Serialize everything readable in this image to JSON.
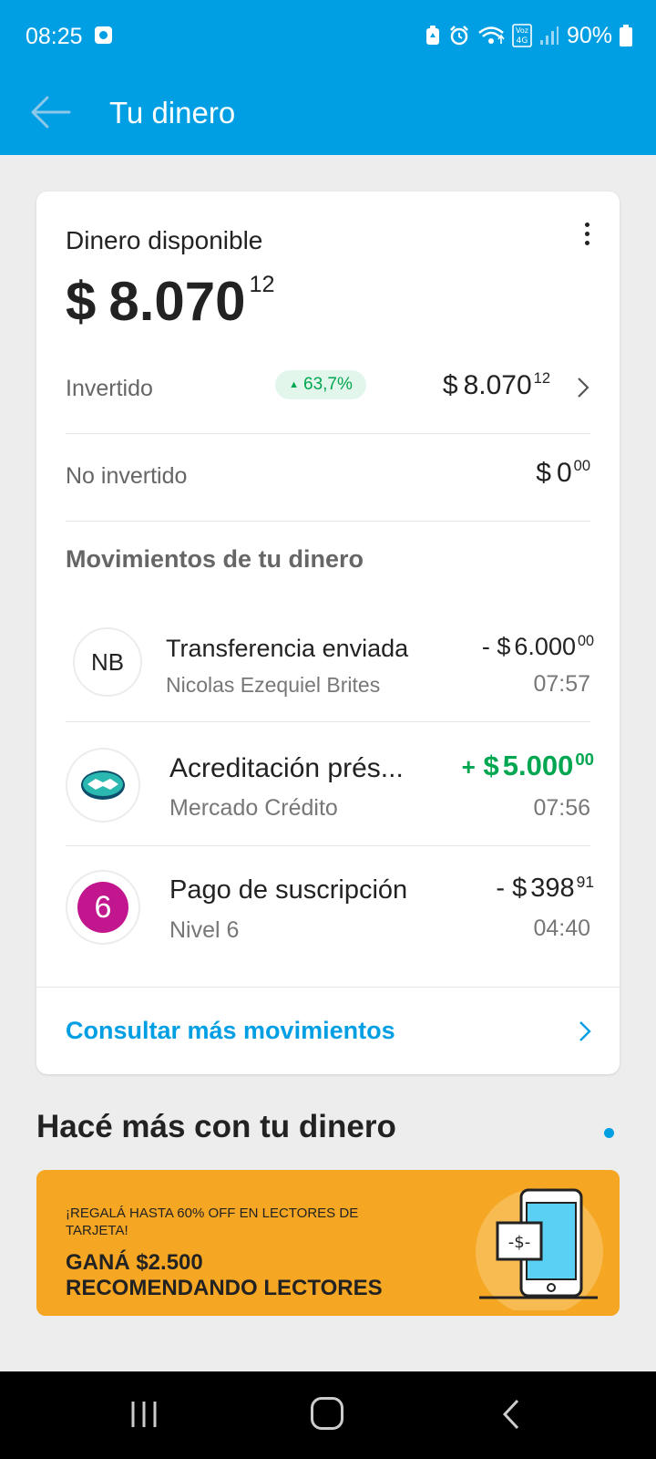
{
  "status_bar": {
    "time": "08:25",
    "battery": "90%",
    "network": "Voz 4G",
    "icons": [
      "notification-icon",
      "battery-saver-icon",
      "alarm-icon",
      "wifi-icon",
      "volte-icon",
      "signal-icon",
      "battery-icon"
    ]
  },
  "header": {
    "title": "Tu dinero",
    "back_icon": "arrow-left-icon",
    "color": "#009ee3"
  },
  "balance": {
    "label": "Dinero disponible",
    "currency": "$",
    "integer": "8.070",
    "cents": "12",
    "menu_icon": "more-vertical-icon"
  },
  "breakdown": [
    {
      "label": "Invertido",
      "badge": "63,7%",
      "badge_trend": "up",
      "currency": "$",
      "integer": "8.070",
      "cents": "12",
      "has_chevron": true
    },
    {
      "label": "No invertido",
      "currency": "$",
      "integer": "0",
      "cents": "00",
      "has_chevron": false
    }
  ],
  "movements": {
    "title": "Movimientos de tu dinero",
    "items": [
      {
        "avatar": "NB",
        "title": "Transferencia enviada",
        "subtitle": "Nicolas Ezequiel Brites",
        "sign": "-",
        "currency": "$",
        "integer": "6.000",
        "cents": "00",
        "time": "07:57",
        "type": "debit"
      },
      {
        "avatar_icon": "handshake-icon",
        "title": "Acreditación prés...",
        "subtitle": "Mercado Crédito",
        "sign": "+",
        "currency": "$",
        "integer": "5.000",
        "cents": "00",
        "time": "07:56",
        "type": "credit"
      },
      {
        "avatar": "6",
        "title": "Pago de suscripción",
        "subtitle": "Nivel 6",
        "sign": "-",
        "currency": "$",
        "integer": "398",
        "cents": "91",
        "time": "04:40",
        "type": "debit"
      }
    ],
    "more_link": "Consultar más movimientos"
  },
  "promo_section": {
    "title": "Hacé más con tu dinero",
    "banner": {
      "subtitle": "¡REGALÁ HASTA 60% OFF EN LECTORES DE TARJETA!",
      "line1": "GANÁ $2.500",
      "line2": "RECOMENDANDO LECTORES",
      "art_text": "-$-",
      "background": "#f5a623"
    }
  },
  "nav_bar": {
    "icons": [
      "recents-icon",
      "home-icon",
      "back-icon"
    ]
  },
  "colors": {
    "primary": "#009ee3",
    "positive": "#00a650",
    "nivel6": "#c2168e",
    "promo": "#f5a623"
  }
}
